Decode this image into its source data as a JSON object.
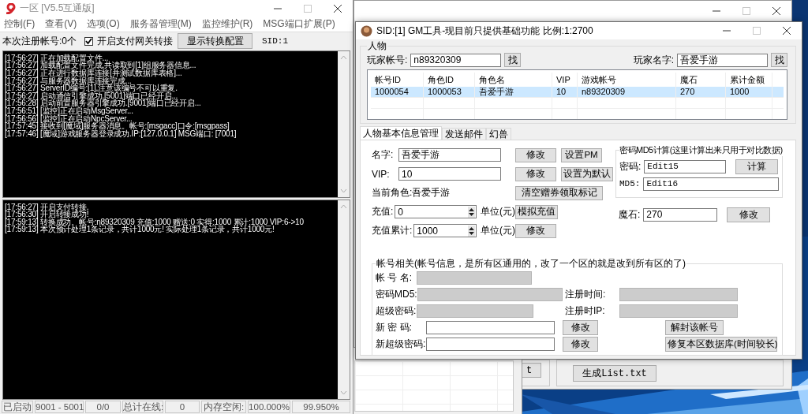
{
  "main_window": {
    "title": "一区 [V5.5互通版]",
    "menu": [
      "控制(F)",
      "查看(V)",
      "选项(O)",
      "服务器管理(M)",
      "监控维护(R)",
      "MSG端口扩展(P)"
    ],
    "register_count": "本次注册帐号:0个",
    "gateway_checkbox": {
      "label": "开启支付网关转接",
      "checked": true
    },
    "config_button": "显示转换配置",
    "sid": "SID:1",
    "upper_log": [
      "[17:56:27] 正在加载配置文件...",
      "[17:56:27] 加载配置文件完成,共读取到[1]组服务器信息...",
      "[17:56:27] 正在进行数据库连接[并测试数据库表格]...",
      "[17:56:27] 与服务器数据库连接完成...",
      "[17:56:27] ServerID编号:[1],注意该编号不可以重复.",
      "[17:56:27] 启动通信引擎成功.[5001]端口已经开启...",
      "[17:56:28] 启动前置服务器引擎成功.[9001]端口已经开启...",
      "[17:56:51] [监控]正在启动MsgServer...",
      "[17:56:56] [监控]正在启动NpcServer...",
      "[17:57:45] 接收到[魔域]服务器消息。帐号:[msgacc]口令:[msgpass]",
      "[17:57:46] [魔域]游戏服务器登录成功.IP:[127.0.0.1] MSG端口: [7001]"
    ],
    "lower_log": [
      "[17:56:27] 开启支付转接.",
      "[17:56:30] 开启转接成功!",
      "[17:59:13] 转换成功。帐号:n89320309 充值:1000 赠送:0 实得:1000 累计:1000 VIP:6->10",
      "[17:59:13] 本次预计处理1条记录，共计1000元! 实际处理1条记录，共计1000元!"
    ],
    "status_bar": [
      "已启动",
      "9001 - 5001",
      "0/0",
      "总计在线:",
      "0",
      "内存空闲:",
      "100.000%",
      "99.950%"
    ]
  },
  "background_window": {
    "partial_button": "t",
    "list_button": "生成List.txt"
  },
  "gm_window": {
    "title": "SID:[1] GM工具-现目前只提供基础功能 比例:1:2700",
    "player_group": {
      "title": "人物",
      "account_label": "玩家帐号:",
      "account_value": "n89320309",
      "name_label": "玩家名字:",
      "name_value": "吾爱手游",
      "find_buttons": [
        "找",
        "找"
      ]
    },
    "table": {
      "columns": [
        "帐号ID",
        "角色ID",
        "角色名",
        "VIP",
        "游戏帐号",
        "魔石",
        "累计金额"
      ],
      "rows": [
        {
          "cells": [
            "1000054",
            "1000053",
            "吾爱手游",
            "10",
            "n89320309",
            "270",
            "1000"
          ],
          "selected": true
        }
      ]
    },
    "tabs": [
      {
        "label": "人物基本信息管理",
        "selected": true
      },
      {
        "label": "发送邮件",
        "selected": false
      },
      {
        "label": "幻兽",
        "selected": false
      }
    ],
    "basic_rows": [
      {
        "kind": "field",
        "label": "名字:",
        "value": "吾爱手游",
        "buttons": [
          "修改",
          "设置PM"
        ]
      },
      {
        "kind": "field",
        "label": "VIP:",
        "value": "10",
        "buttons": [
          "修改",
          "设置为默认"
        ]
      },
      {
        "kind": "text",
        "text": "当前角色:吾爱手游",
        "buttons": [
          "清空赠券领取标记"
        ]
      },
      {
        "kind": "spin",
        "label": "充值:",
        "value": "0",
        "unit": "单位(元)",
        "buttons": [
          "模拟充值"
        ]
      },
      {
        "kind": "spin",
        "label": "充值累计:",
        "value": "1000",
        "unit": "单位(元)",
        "buttons": [
          "修改"
        ]
      }
    ],
    "md5_group": {
      "title": "密码MD5计算(这里计算出来只用于对比数据)",
      "password_label": "密码:",
      "password_value": "Edit15",
      "calc_button": "计算",
      "md5_label": "MD5:",
      "md5_value": "Edit16"
    },
    "magic_stone": {
      "label": "魔石:",
      "value": "270",
      "button": "修改"
    },
    "account_group": {
      "title": "帐号相关(帐号信息，是所有区通用的，改了一个区的就是改到所有区的了)",
      "rows": [
        {
          "fields": [
            {
              "label": "帐 号 名:",
              "disabled": true
            }
          ]
        },
        {
          "fields": [
            {
              "label": "密码MD5:",
              "disabled": true
            },
            {
              "label": "注册时间:",
              "disabled": true
            }
          ]
        },
        {
          "fields": [
            {
              "label": "超级密码:",
              "disabled": true
            },
            {
              "label": "注册时IP:",
              "disabled": true
            }
          ]
        },
        {
          "fields": [
            {
              "label": "新 密 码:",
              "disabled": false,
              "button": "修改"
            }
          ],
          "action": "解封该帐号"
        },
        {
          "fields": [
            {
              "label": "新超级密码:",
              "disabled": false,
              "button": "修改"
            }
          ],
          "action": "修复本区数据库(时间较长)"
        }
      ]
    }
  }
}
